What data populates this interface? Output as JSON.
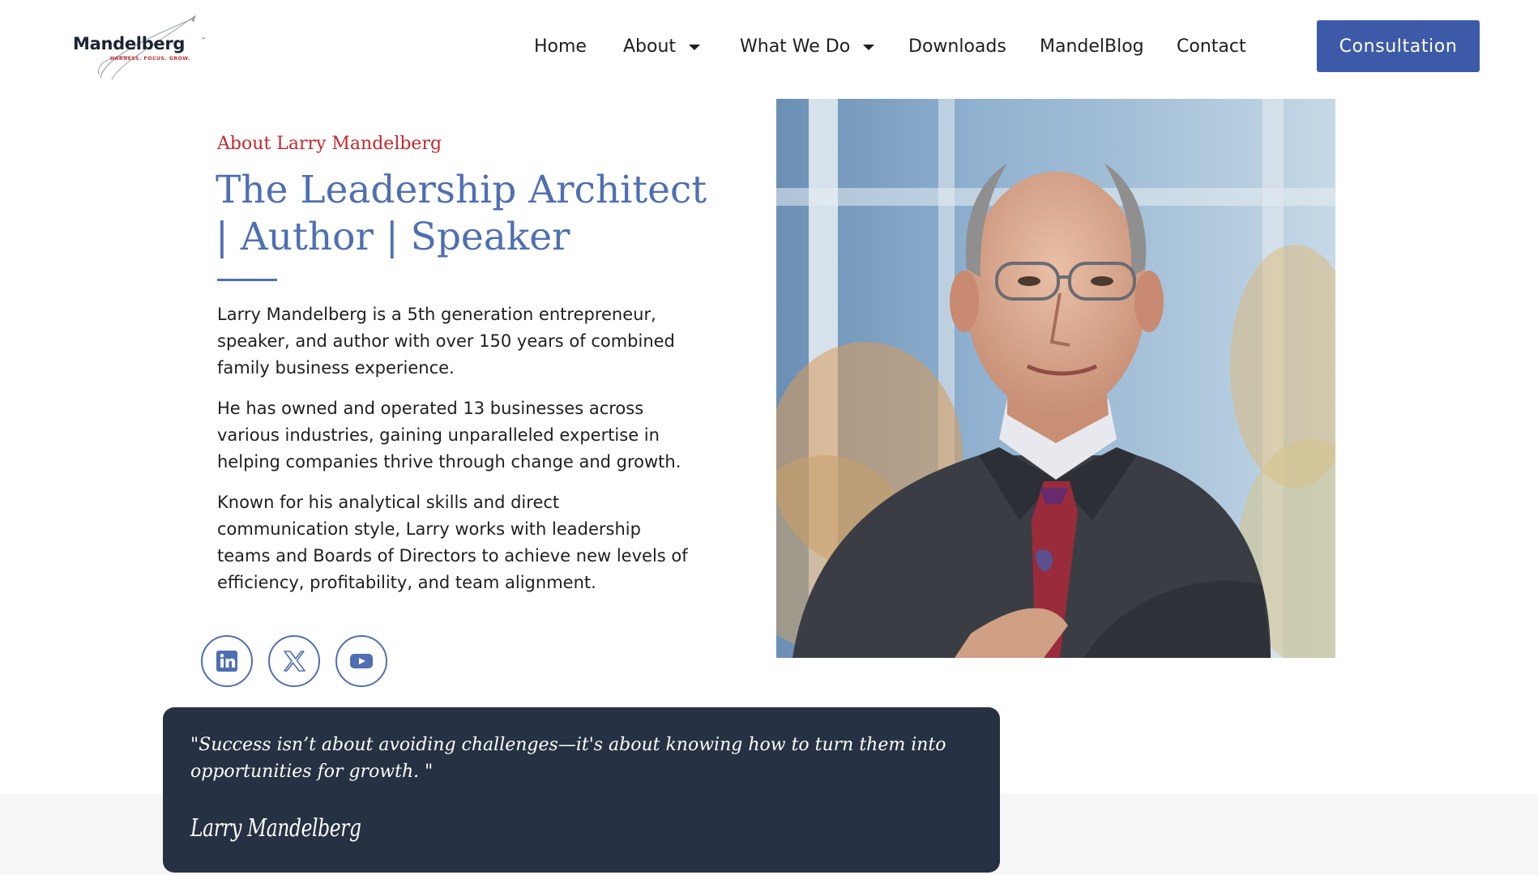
{
  "brand": {
    "name": "Mandelberg",
    "trademark": "™",
    "tagline": "HARNESS. FOCUS. GROW."
  },
  "nav": {
    "items": [
      {
        "label": "Home",
        "has_dropdown": false
      },
      {
        "label": "About",
        "has_dropdown": true
      },
      {
        "label": "What We Do",
        "has_dropdown": true
      },
      {
        "label": "Downloads",
        "has_dropdown": false
      },
      {
        "label": "MandelBlog",
        "has_dropdown": false
      },
      {
        "label": "Contact",
        "has_dropdown": false
      }
    ],
    "cta_label": "Consultation"
  },
  "about": {
    "eyebrow": "About Larry Mandelberg",
    "title": "The Leadership Architect | Author | Speaker",
    "paragraphs": [
      "Larry Mandelberg is a 5th generation entrepreneur, speaker, and author with over 150 years of combined family business experience.",
      "He has owned and operated 13 businesses across various industries, gaining unparalleled expertise in helping companies thrive through change and growth.",
      "Known for his analytical skills and direct communication style, Larry works with leadership teams and Boards of Directors to achieve new levels of efficiency, profitability, and team alignment."
    ]
  },
  "social": [
    {
      "network": "LinkedIn",
      "icon": "linkedin-icon"
    },
    {
      "network": "X",
      "icon": "x-icon"
    },
    {
      "network": "YouTube",
      "icon": "youtube-icon"
    }
  ],
  "photo": {
    "subject": "portrait-photo"
  },
  "quote": {
    "text": "\"Success isn’t about avoiding challenges—it's about knowing how to turn them into opportunities for growth. \"",
    "author": "Larry Mandelberg"
  },
  "colors": {
    "accent_blue": "#4f6fb2",
    "button_blue": "#3d5aa8",
    "accent_red": "#c7262b",
    "quote_bg": "#263243",
    "text_dark": "#1e1e1e"
  }
}
